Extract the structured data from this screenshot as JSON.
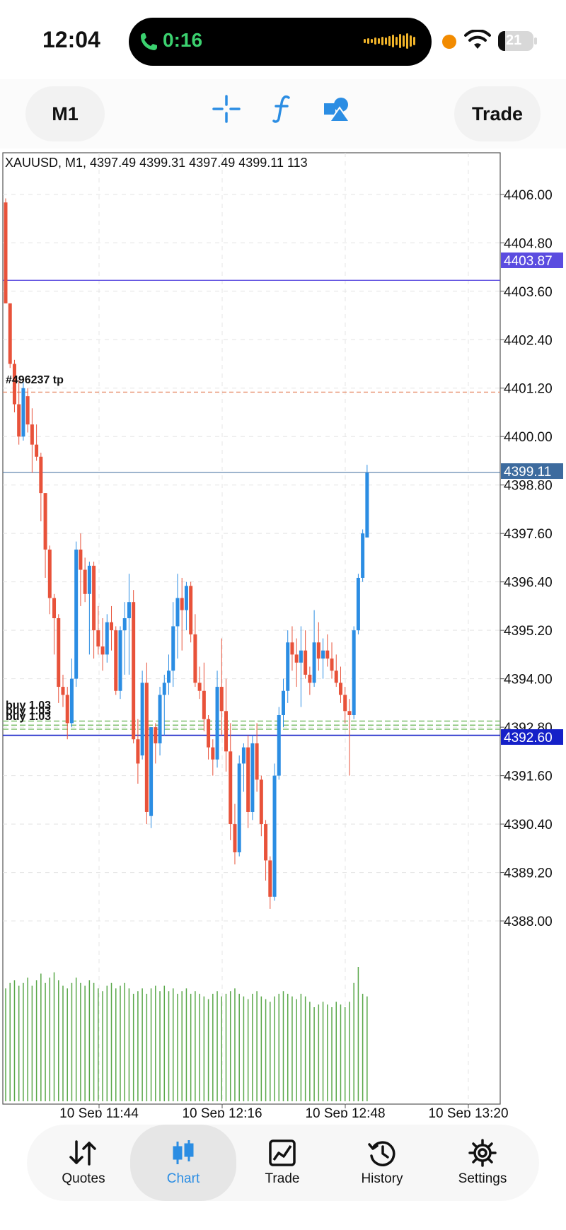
{
  "status_bar": {
    "time": "12:04",
    "call_timer": "0:16",
    "battery_level": "21",
    "icons": [
      "phone-icon",
      "waveform-icon",
      "recording-dot-icon",
      "wifi-icon",
      "battery-icon"
    ]
  },
  "toolbar": {
    "timeframe": "M1",
    "trade_label": "Trade",
    "icons": [
      "crosshair-icon",
      "indicators-icon",
      "objects-icon"
    ]
  },
  "chart": {
    "header": "XAUUSD, M1, 4397.49 4399.31 4397.49 4399.11 113",
    "order_label": "#496237 tp",
    "buy_label": "buy 1.03",
    "price_tags": {
      "upper_line": "4403.87",
      "bid": "4399.11",
      "lower_line": "4392.60"
    },
    "colors": {
      "bull": "#2b8de3",
      "bear": "#e8523a",
      "volume": "#5aa84a",
      "upper_line": "#5b4ce0",
      "bid_line": "#3d6b9e",
      "lower_line": "#1520c8"
    }
  },
  "chart_data": {
    "type": "candlestick",
    "symbol": "XAUUSD",
    "timeframe": "M1",
    "y_ticks": [
      "4406.00",
      "4404.80",
      "4403.60",
      "4402.40",
      "4401.20",
      "4400.00",
      "4398.80",
      "4397.60",
      "4396.40",
      "4395.20",
      "4394.00",
      "4392.80",
      "4391.60",
      "4390.40",
      "4389.20",
      "4388.00"
    ],
    "y_range": [
      4387.3,
      4406.75
    ],
    "x_ticks": [
      "10 Sep 11:44",
      "10 Sep 12:16",
      "10 Sep 12:48",
      "10 Sep 13:20"
    ],
    "horizontal_lines": [
      4403.87,
      4401.1,
      4399.11,
      4392.6,
      4392.75,
      4392.85,
      4392.95
    ],
    "candles": [
      [
        4405.8,
        4405.9,
        4403.3,
        4403.3
      ],
      [
        4403.3,
        4403.3,
        4401.7,
        4401.8
      ],
      [
        4401.8,
        4401.9,
        4400.6,
        4400.8
      ],
      [
        4400.8,
        4401.4,
        4399.8,
        4400.0
      ],
      [
        4400.0,
        4401.4,
        4399.9,
        4401.2
      ],
      [
        4401.0,
        4401.2,
        4400.1,
        4400.3
      ],
      [
        4400.3,
        4400.7,
        4399.1,
        4399.8
      ],
      [
        4399.8,
        4400.3,
        4399.4,
        4399.5
      ],
      [
        4399.5,
        4399.6,
        4397.9,
        4398.6
      ],
      [
        4398.6,
        4398.6,
        4396.5,
        4397.2
      ],
      [
        4397.2,
        4397.3,
        4395.6,
        4396.0
      ],
      [
        4396.0,
        4396.1,
        4394.6,
        4395.5
      ],
      [
        4395.5,
        4395.6,
        4393.4,
        4393.8
      ],
      [
        4393.8,
        4394.1,
        4393.3,
        4393.6
      ],
      [
        4393.6,
        4393.8,
        4392.5,
        4392.9
      ],
      [
        4392.9,
        4394.5,
        4392.8,
        4394.0
      ],
      [
        4394.0,
        4397.4,
        4393.8,
        4397.2
      ],
      [
        4397.2,
        4397.6,
        4395.8,
        4396.7
      ],
      [
        4396.7,
        4397.0,
        4395.9,
        4396.1
      ],
      [
        4396.1,
        4396.9,
        4394.6,
        4396.8
      ],
      [
        4396.8,
        4396.9,
        4394.5,
        4395.2
      ],
      [
        4395.2,
        4395.8,
        4394.6,
        4394.8
      ],
      [
        4394.8,
        4395.5,
        4394.2,
        4394.6
      ],
      [
        4394.6,
        4395.6,
        4394.4,
        4395.4
      ],
      [
        4395.4,
        4395.8,
        4394.7,
        4395.2
      ],
      [
        4395.2,
        4395.3,
        4393.6,
        4393.7
      ],
      [
        4393.7,
        4395.3,
        4393.5,
        4395.2
      ],
      [
        4395.2,
        4395.9,
        4394.1,
        4395.5
      ],
      [
        4395.5,
        4396.6,
        4394.1,
        4395.9
      ],
      [
        4395.9,
        4396.2,
        4392.4,
        4392.5
      ],
      [
        4392.5,
        4393.0,
        4391.4,
        4391.9
      ],
      [
        4392.1,
        4394.2,
        4392.0,
        4393.9
      ],
      [
        4393.9,
        4394.4,
        4390.4,
        4390.7
      ],
      [
        4390.6,
        4392.8,
        4390.3,
        4392.8
      ],
      [
        4392.8,
        4392.9,
        4391.9,
        4392.4
      ],
      [
        4392.4,
        4393.8,
        4392.1,
        4393.6
      ],
      [
        4393.6,
        4394.1,
        4392.6,
        4393.9
      ],
      [
        4393.9,
        4394.6,
        4393.6,
        4394.2
      ],
      [
        4394.2,
        4395.9,
        4393.8,
        4395.3
      ],
      [
        4395.3,
        4396.6,
        4394.5,
        4396.0
      ],
      [
        4396.0,
        4396.5,
        4394.7,
        4395.7
      ],
      [
        4395.7,
        4396.4,
        4395.2,
        4396.3
      ],
      [
        4396.3,
        4396.4,
        4394.9,
        4395.1
      ],
      [
        4395.1,
        4395.6,
        4393.8,
        4393.9
      ],
      [
        4393.9,
        4394.3,
        4393.5,
        4393.7
      ],
      [
        4393.7,
        4394.4,
        4392.7,
        4393.0
      ],
      [
        4393.0,
        4393.1,
        4392.0,
        4392.3
      ],
      [
        4392.3,
        4392.5,
        4391.6,
        4392.0
      ],
      [
        4392.0,
        4394.2,
        4391.8,
        4393.8
      ],
      [
        4393.8,
        4395.0,
        4392.6,
        4393.2
      ],
      [
        4393.2,
        4394.0,
        4391.7,
        4392.2
      ],
      [
        4392.2,
        4392.9,
        4390.0,
        4390.4
      ],
      [
        4390.4,
        4390.9,
        4389.4,
        4389.7
      ],
      [
        4389.7,
        4392.1,
        4389.6,
        4391.9
      ],
      [
        4391.9,
        4392.4,
        4391.2,
        4392.3
      ],
      [
        4392.3,
        4392.6,
        4390.3,
        4390.7
      ],
      [
        4390.7,
        4392.6,
        4390.5,
        4392.4
      ],
      [
        4392.4,
        4392.9,
        4391.2,
        4391.5
      ],
      [
        4391.5,
        4391.6,
        4390.1,
        4390.4
      ],
      [
        4390.4,
        4390.5,
        4389.0,
        4389.5
      ],
      [
        4389.5,
        4389.6,
        4388.3,
        4388.6
      ],
      [
        4388.6,
        4391.9,
        4388.5,
        4391.6
      ],
      [
        4391.6,
        4393.3,
        4391.5,
        4393.1
      ],
      [
        4393.1,
        4394.0,
        4392.8,
        4393.7
      ],
      [
        4393.7,
        4395.2,
        4393.4,
        4394.9
      ],
      [
        4394.9,
        4395.3,
        4394.2,
        4394.6
      ],
      [
        4394.6,
        4395.0,
        4393.8,
        4394.4
      ],
      [
        4394.4,
        4395.3,
        4393.3,
        4394.7
      ],
      [
        4394.7,
        4395.2,
        4394.0,
        4394.1
      ],
      [
        4394.1,
        4394.3,
        4393.6,
        4393.9
      ],
      [
        4393.9,
        4395.7,
        4393.8,
        4394.9
      ],
      [
        4394.9,
        4395.4,
        4394.2,
        4394.5
      ],
      [
        4394.5,
        4395.0,
        4394.0,
        4394.7
      ],
      [
        4394.7,
        4395.1,
        4394.3,
        4394.5
      ],
      [
        4394.5,
        4394.9,
        4394.0,
        4394.2
      ],
      [
        4394.2,
        4394.6,
        4393.8,
        4393.9
      ],
      [
        4393.9,
        4394.3,
        4393.4,
        4393.6
      ],
      [
        4393.6,
        4393.8,
        4392.9,
        4393.2
      ],
      [
        4393.2,
        4393.5,
        4391.6,
        4393.1
      ],
      [
        4393.1,
        4395.3,
        4393.0,
        4395.2
      ],
      [
        4395.2,
        4396.6,
        4395.1,
        4396.5
      ],
      [
        4396.5,
        4397.7,
        4396.4,
        4397.6
      ],
      [
        4397.5,
        4399.3,
        4397.5,
        4399.1
      ]
    ],
    "volumes": [
      84,
      88,
      90,
      86,
      88,
      92,
      86,
      90,
      95,
      88,
      92,
      96,
      90,
      86,
      84,
      88,
      92,
      88,
      86,
      90,
      88,
      84,
      82,
      86,
      88,
      84,
      86,
      88,
      84,
      80,
      82,
      84,
      80,
      84,
      86,
      82,
      86,
      82,
      84,
      80,
      82,
      84,
      80,
      82,
      80,
      78,
      76,
      80,
      82,
      78,
      80,
      82,
      84,
      80,
      78,
      76,
      80,
      82,
      78,
      76,
      74,
      78,
      80,
      82,
      80,
      78,
      76,
      80,
      78,
      74,
      70,
      72,
      74,
      72,
      70,
      74,
      72,
      70,
      74,
      88,
      100,
      80,
      78
    ],
    "volume_max": 100
  },
  "nav": {
    "items": [
      {
        "label": "Quotes",
        "icon": "quotes-arrows-icon"
      },
      {
        "label": "Chart",
        "icon": "chart-candles-icon"
      },
      {
        "label": "Trade",
        "icon": "trade-chart-icon"
      },
      {
        "label": "History",
        "icon": "history-clock-icon"
      },
      {
        "label": "Settings",
        "icon": "settings-gear-icon"
      }
    ]
  }
}
